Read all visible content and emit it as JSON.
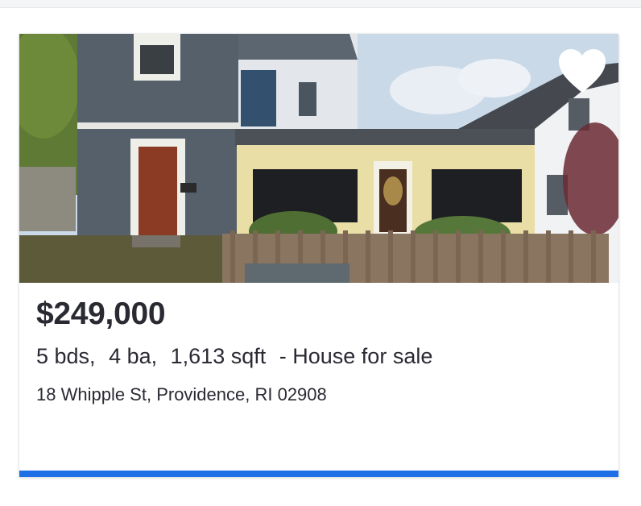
{
  "listing": {
    "price": "$249,000",
    "beds": "5 bds,",
    "baths": "4 ba,",
    "sqft": "1,613 sqft",
    "type": "- House for sale",
    "address": "18 Whipple St, Providence, RI 02908",
    "favorite_icon": "heart-icon",
    "photo_subject": "house-photo"
  },
  "colors": {
    "accent": "#1f6fe6",
    "text": "#2a2a33",
    "favorite_fill": "#ffffff"
  }
}
